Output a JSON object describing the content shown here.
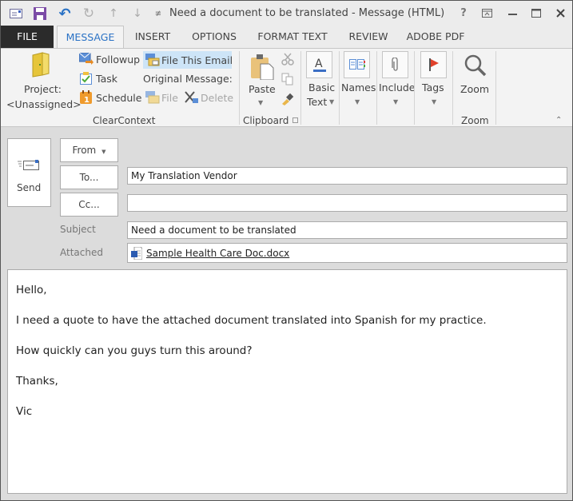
{
  "window": {
    "title": "Need a document to be translated - Message (HTML)",
    "controls": {
      "help": "?",
      "ribbon_display": "ribbon-display-icon",
      "minimize": "minimize-icon",
      "maximize": "maximize-icon",
      "close": "close-icon"
    }
  },
  "quick_access": [
    "message-icon",
    "save-icon",
    "undo-icon",
    "redo-icon",
    "previous-item-icon",
    "next-item-icon",
    "customize-icon"
  ],
  "tabs": [
    {
      "label": "FILE"
    },
    {
      "label": "MESSAGE",
      "active": true
    },
    {
      "label": "INSERT"
    },
    {
      "label": "OPTIONS"
    },
    {
      "label": "FORMAT TEXT"
    },
    {
      "label": "REVIEW"
    },
    {
      "label": "ADOBE PDF"
    }
  ],
  "ribbon": {
    "clearcontext": {
      "label": "ClearContext",
      "project_line1": "Project:",
      "project_line2": "<Unassigned>",
      "followup": "Followup",
      "task": "Task",
      "schedule": "Schedule",
      "file_this_email": "File This Email",
      "original_message": "Original Message:",
      "file": "File",
      "delete": "Delete"
    },
    "clipboard": {
      "label": "Clipboard",
      "paste": "Paste"
    },
    "basic_text": {
      "line1": "Basic",
      "line2": "Text"
    },
    "names": {
      "label": "Names"
    },
    "include": {
      "label": "Include"
    },
    "tags": {
      "label": "Tags"
    },
    "zoom": {
      "button": "Zoom",
      "label": "Zoom"
    }
  },
  "header": {
    "send": "Send",
    "from": "From",
    "to_button": "To...",
    "cc_button": "Cc...",
    "to_value": "My Translation Vendor",
    "cc_value": "",
    "subject_label": "Subject",
    "subject_value": "Need a document to be translated",
    "attached_label": "Attached",
    "attachment": "Sample Health Care Doc.docx"
  },
  "colors": {
    "accent": "#2a72c5",
    "file_tab": "#2b2b2b",
    "highlight": "#cde4f7"
  },
  "body": {
    "lines": [
      "Hello,",
      "I need a quote to have the attached document translated into Spanish for my practice.",
      "How quickly can you guys turn this around?",
      "Thanks,",
      "Vic"
    ]
  }
}
